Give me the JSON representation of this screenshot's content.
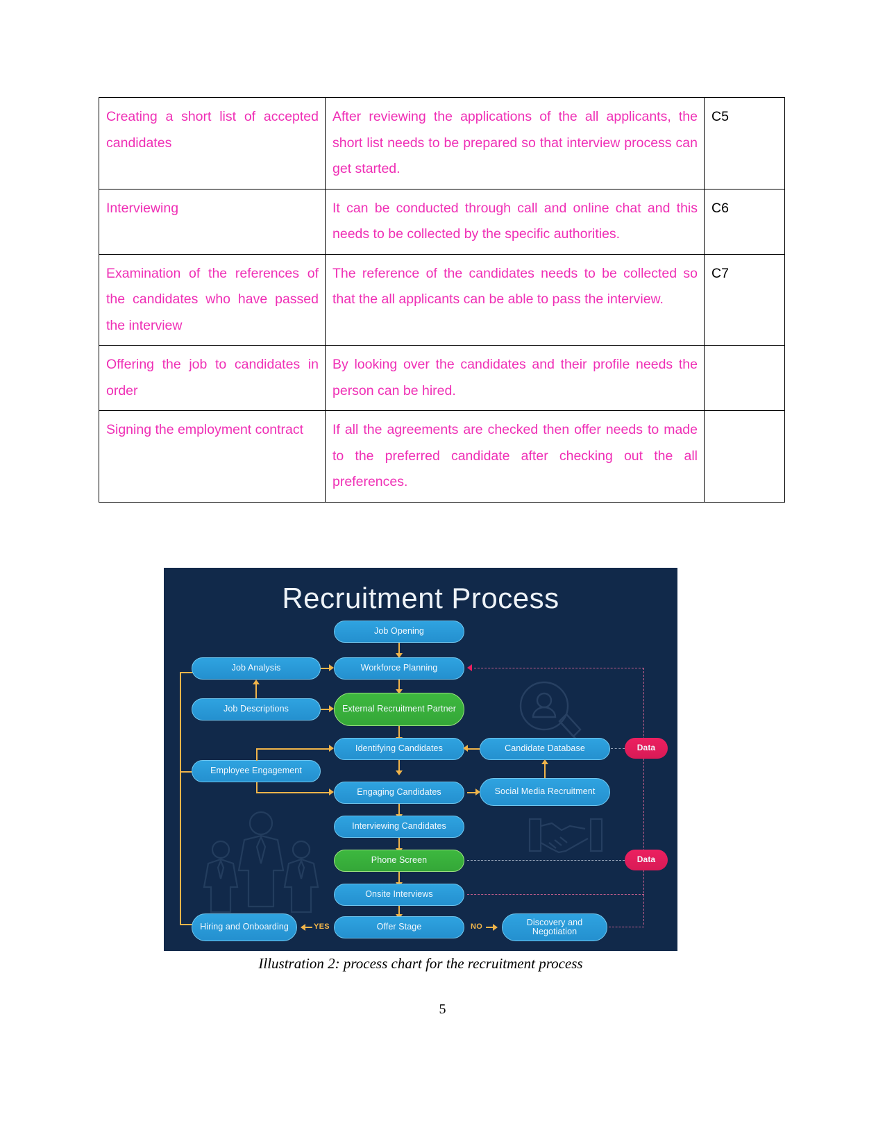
{
  "table": {
    "rows": [
      {
        "activity": "Creating a short list of accepted candidates",
        "description": "After reviewing the applications of the all applicants, the short list needs to be prepared so that interview process can get started.",
        "code": "C5"
      },
      {
        "activity": "Interviewing",
        "description": "It can be conducted through call and online chat and this needs to be collected by the specific authorities.",
        "code": "C6"
      },
      {
        "activity": "Examination of the references of the candidates who have passed the interview",
        "description": "The reference of the candidates needs to be collected so that the all applicants can be able to pass the interview.",
        "code": "C7"
      },
      {
        "activity": "Offering the job to candidates in order",
        "description": "By looking over the candidates and their profile needs the person can be hired.",
        "code": ""
      },
      {
        "activity": "Signing the employment contract",
        "description": "If all the agreements are checked then offer needs to made to the preferred candidate after checking out the all preferences.",
        "code": ""
      }
    ]
  },
  "figure": {
    "caption": "Illustration 2:  process chart for the recruitment process",
    "title": "Recruitment Process",
    "colors": {
      "background": "#11294a",
      "blue_node": "#2fa3e0",
      "green_node": "#3db83f",
      "pink_node": "#ec2060",
      "connector": "#f0b44a",
      "title_text": "#eef3f8"
    },
    "nodes": {
      "job_opening": "Job Opening",
      "job_analysis": "Job Analysis",
      "workforce_planning": "Workforce Planning",
      "job_descriptions": "Job Descriptions",
      "external_recruitment_partner": "External Recruitment Partner",
      "identifying_candidates": "Identifying Candidates",
      "candidate_database": "Candidate Database",
      "data_top": "Data",
      "employee_engagement": "Employee Engagement",
      "engaging_candidates": "Engaging Candidates",
      "social_media_recruitment": "Social Media Recruitment",
      "interviewing_candidates": "Interviewing Candidates",
      "phone_screen": "Phone Screen",
      "data_bottom": "Data",
      "onsite_interviews": "Onsite Interviews",
      "hiring_and_onboarding": "Hiring and Onboarding",
      "offer_stage": "Offer Stage",
      "discovery_and_negotiation": "Discovery and Negotiation"
    },
    "branch_labels": {
      "yes": "YES",
      "no": "NO"
    }
  },
  "page": {
    "number": "5"
  }
}
